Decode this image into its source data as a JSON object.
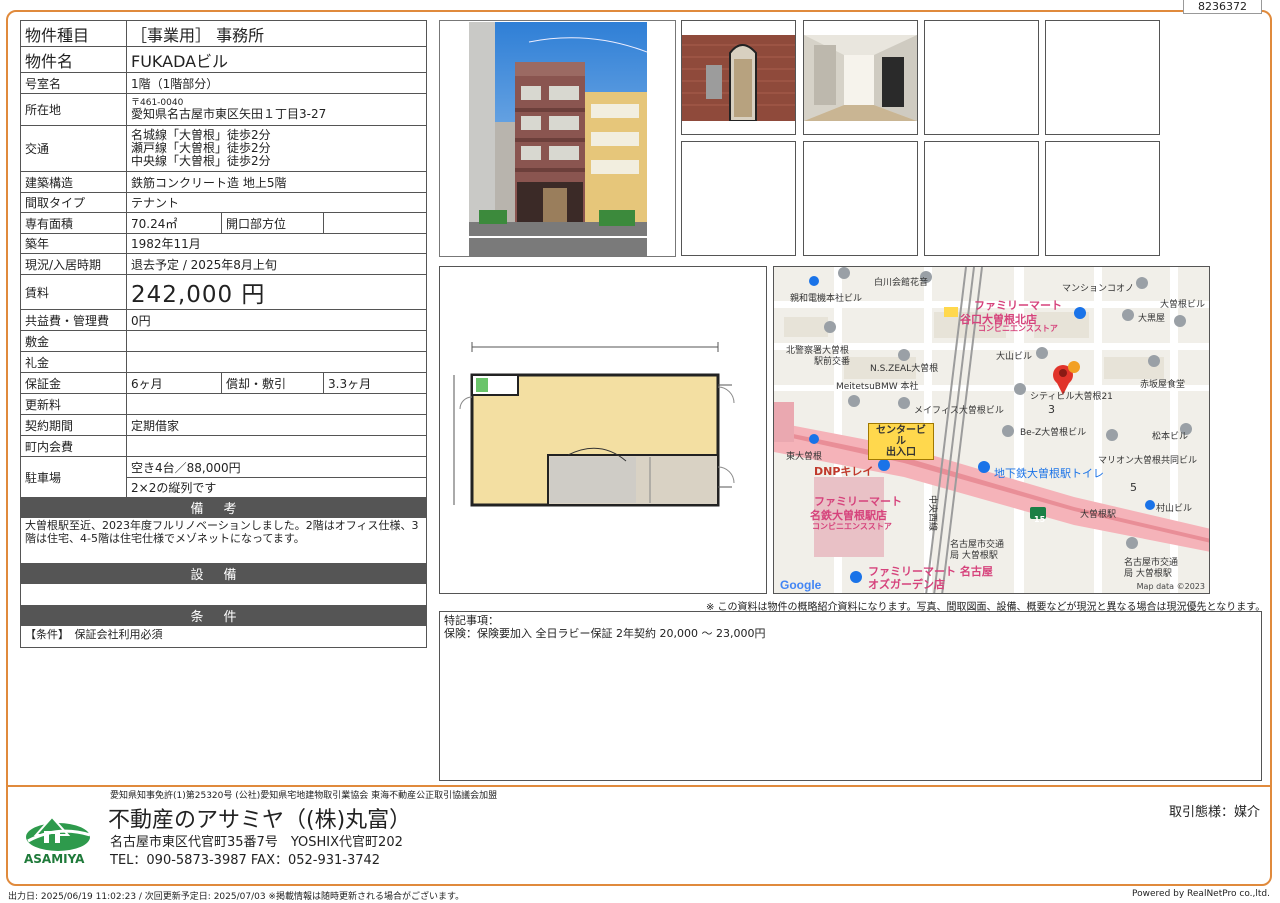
{
  "doc_id": "8236372",
  "spec": {
    "type_label": "物件種目",
    "type_value": "［事業用］ 事務所",
    "name_label": "物件名",
    "name_value": "FUKADAビル",
    "room_label": "号室名",
    "room_value": "1階（1階部分）",
    "address_label": "所在地",
    "postal": "〒461-0040",
    "address_value": "愛知県名古屋市東区矢田１丁目3-27",
    "transit_label": "交通",
    "transit_lines": [
      "名城線「大曽根」徒歩2分",
      "瀬戸線「大曽根」徒歩2分",
      "中央線「大曽根」徒歩2分"
    ],
    "structure_label": "建築構造",
    "structure_value": "鉄筋コンクリート造 地上5階",
    "layout_label": "間取タイプ",
    "layout_value": "テナント",
    "area_label": "専有面積",
    "area_value": "70.24㎡",
    "opening_label": "開口部方位",
    "opening_value": "",
    "built_label": "築年",
    "built_value": "1982年11月",
    "status_label": "現況/入居時期",
    "status_value": "退去予定 / 2025年8月上旬",
    "rent_label": "賃料",
    "rent_value": "242,000 円",
    "fee_label": "共益費・管理費",
    "fee_value": "0円",
    "deposit_label": "敷金",
    "deposit_value": "",
    "keymoney_label": "礼金",
    "keymoney_value": "",
    "guarantee_label": "保証金",
    "guarantee_value": "6ヶ月",
    "amort_label": "償却・敷引",
    "amort_value": "3.3ヶ月",
    "renewal_label": "更新料",
    "renewal_value": "",
    "contract_label": "契約期間",
    "contract_value": "定期借家",
    "community_label": "町内会費",
    "community_value": "",
    "parking_label": "駐車場",
    "parking_value1": "空き4台／88,000円",
    "parking_value2": "2×2の縦列です",
    "remarks_head": "備考",
    "remarks_text": "大曽根駅至近、2023年度フルリノベーションしました。2階はオフィス仕様、3階は住宅、4-5階は住宅仕様でメゾネットになってます。",
    "equipment_head": "設備",
    "equipment_text": "",
    "conditions_head": "条件",
    "conditions_text": "【条件】　保証会社利用必須"
  },
  "map": {
    "labels": [
      {
        "t": "白川会館花音"
      },
      {
        "t": "マンションコオノ"
      },
      {
        "t": "親和電機本社ビル"
      },
      {
        "t": "ファミリーマート"
      },
      {
        "t": "谷口大曽根北店"
      },
      {
        "t": "コンビニエンスストア"
      },
      {
        "t": "大曽根ビル"
      },
      {
        "t": "大黒屋"
      },
      {
        "t": "北警察署大曽根"
      },
      {
        "t": "駅前交番"
      },
      {
        "t": "N.S.ZEAL大曽根"
      },
      {
        "t": "大山ビル"
      },
      {
        "t": "MeitetsuBMW 本社"
      },
      {
        "t": "シティビル大曽根21"
      },
      {
        "t": "赤坂屋食堂"
      },
      {
        "t": "メイフィス大曽根ビル"
      },
      {
        "t": "センタービル"
      },
      {
        "t": "出入口"
      },
      {
        "t": "Be-Z大曽根ビル"
      },
      {
        "t": "松本ビル"
      },
      {
        "t": "東大曽根"
      },
      {
        "t": "DNPキレイ"
      },
      {
        "t": "地下鉄大曽根駅トイレ"
      },
      {
        "t": "マリオン大曽根共同ビル"
      },
      {
        "t": "ファミリーマート"
      },
      {
        "t": "名鉄大曽根駅店"
      },
      {
        "t": "コンビニエンスストア"
      },
      {
        "t": "大曽根駅"
      },
      {
        "t": "村山ビル"
      },
      {
        "t": "中央西線"
      },
      {
        "t": "名古屋市交通"
      },
      {
        "t": "局 大曽根駅"
      },
      {
        "t": "ファミリーマート 名古屋"
      },
      {
        "t": "オズガーデン店"
      },
      {
        "t": "名古屋市交通"
      },
      {
        "t": "局 大曽根駅"
      },
      {
        "t": "3"
      },
      {
        "t": "5"
      },
      {
        "t": "15"
      }
    ],
    "google": "Google",
    "copyright": "Map data ©2023"
  },
  "notice": "※ この資料は物件の概略紹介資料になります。写真、間取図面、設備、概要などが現況と異なる場合は現況優先となります。",
  "special_label": "特記事項：",
  "special_text": "保険：保険要加入 全日ラビー保証 2年契約 20,000 ～ 23,000円",
  "footer": {
    "license": "愛知県知事免許(1)第25320号 (公社)愛知県宅地建物取引業協会 東海不動産公正取引協議会加盟",
    "company": "不動産のアサミヤ（(株)丸富）",
    "address": "名古屋市東区代官町35番7号　YOSHIX代官町202",
    "tel": "TEL：090-5873-3987 FAX：052-931-3742",
    "torihiki": "取引態様：媒介",
    "logo_text": "ASAMIYA",
    "output_date": "出力日: 2025/06/19 11:02:23 / 次回更新予定日: 2025/07/03 ※掲載情報は随時更新される場合がございます。",
    "powered": "Powered by RealNetPro co.,ltd."
  }
}
